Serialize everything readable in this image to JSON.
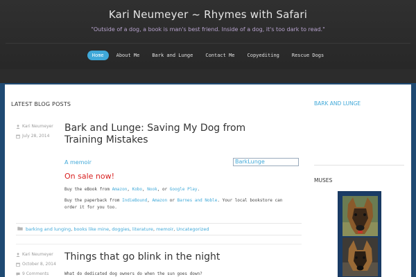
{
  "site": {
    "title": "Kari Neumeyer ~ Rhymes with Safari",
    "tagline": "\"Outside of a dog, a book is man's best friend. Inside of a dog, it's too dark to read.\""
  },
  "nav": {
    "items": [
      {
        "label": "Home",
        "active": true
      },
      {
        "label": "About Me"
      },
      {
        "label": "Bark and Lunge"
      },
      {
        "label": "Contact Me"
      },
      {
        "label": "Copyediting"
      },
      {
        "label": "Rescue Dogs"
      }
    ]
  },
  "main": {
    "section_title": "LATEST BLOG POSTS",
    "posts": [
      {
        "author": "Kari Neumeyer",
        "date": "July 28, 2014",
        "title": "Bark and Lunge: Saving My Dog from Training Mistakes",
        "memoir_link": "A memoir",
        "image_alt": "BarkLunge",
        "on_sale": "On sale now!",
        "ebook_prefix": "Buy the eBook from",
        "ebook_links": [
          "Amazon",
          "Kobo",
          "Nook",
          "Google Play"
        ],
        "paperback_prefix": "Buy the paperback from",
        "paperback_links": [
          "IndieBound",
          "Amazon",
          "Barnes and Noble"
        ],
        "paperback_suffix": ". Your local bookstore can order it for you too.",
        "tags": [
          "barking and lunging",
          "books like mine",
          "doggies",
          "literature",
          "memoir",
          "Uncategorized"
        ]
      },
      {
        "author": "Kari Neumeyer",
        "date": "October 8, 2014",
        "comments": "9 Comments",
        "title": "Things that go blink in the night",
        "excerpt": "What do dedicated dog owners do when the sun goes down?"
      }
    ]
  },
  "sidebar": {
    "widget1_title": "BARK AND LUNGE",
    "widget2_title": "MUSES"
  },
  "colors": {
    "accent": "#3fa8d8",
    "header_bg": "#2b2b2b",
    "body_bg": "#1f4a73",
    "sale_red": "#d82020",
    "tagline_purple": "#b8a4cf"
  },
  "icons": {
    "author": "person-icon",
    "date": "calendar-icon",
    "comments": "comment-icon",
    "tags": "folder-icon"
  }
}
